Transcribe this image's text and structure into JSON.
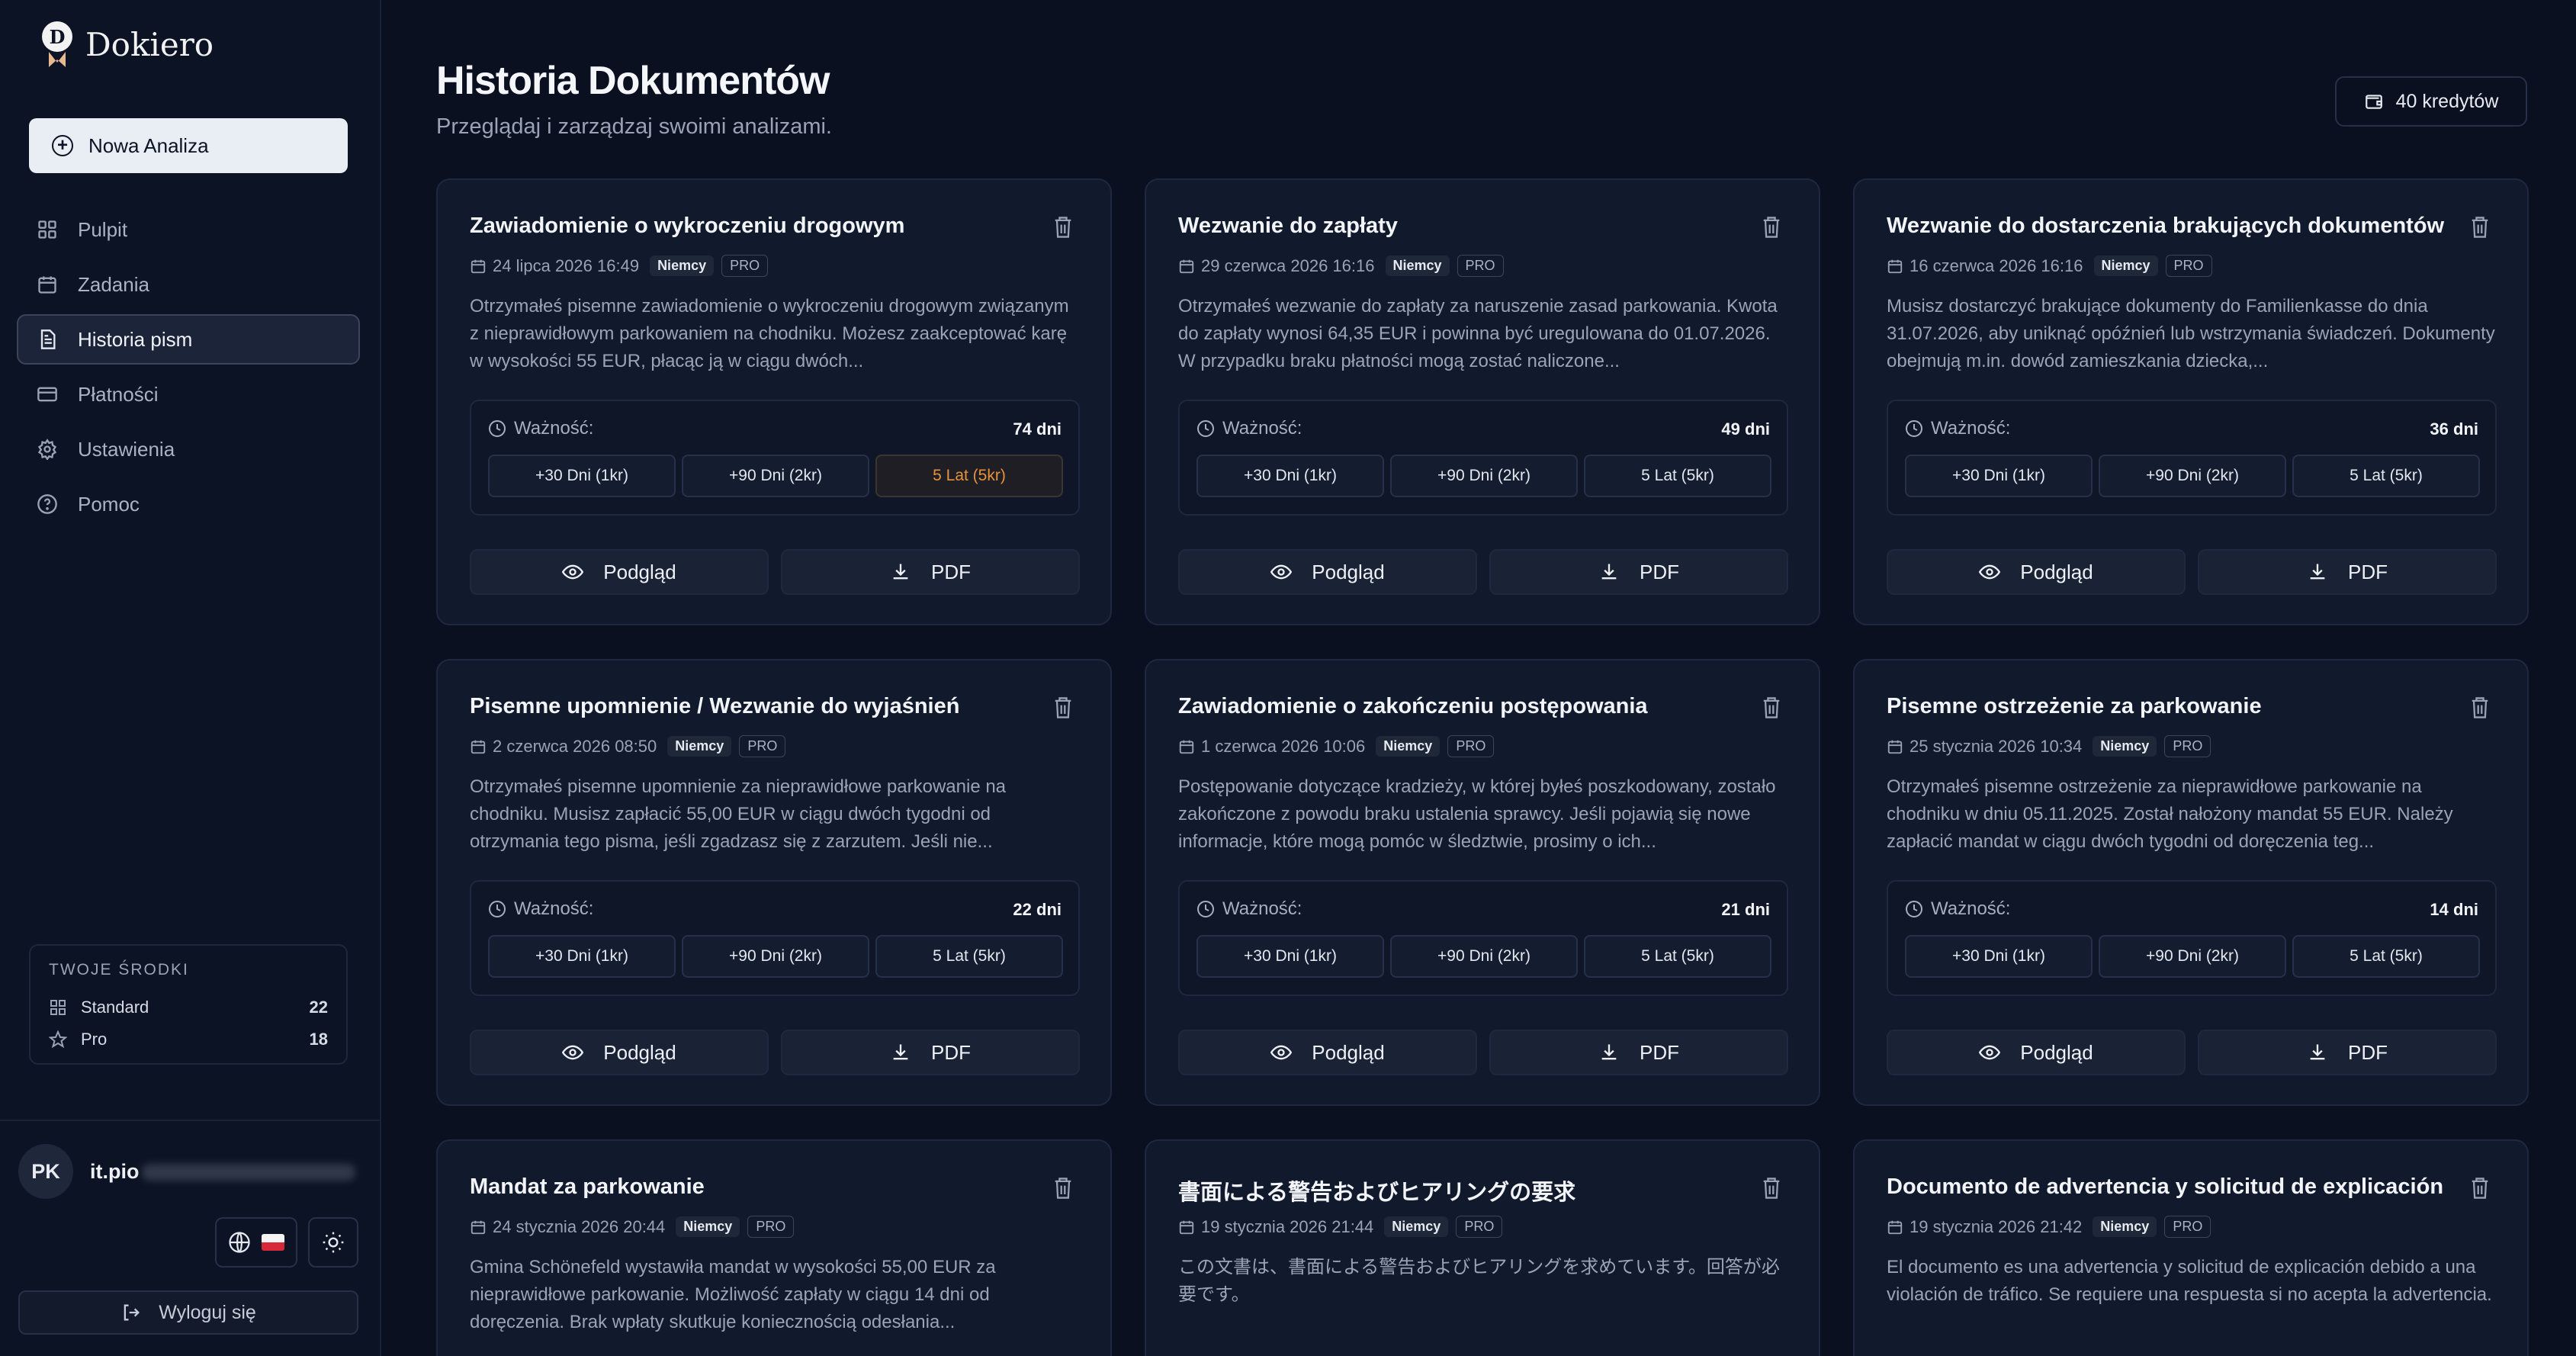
{
  "brand": {
    "name": "Dokiero",
    "logo_letter": "D"
  },
  "sidebar": {
    "new_analysis": "Nowa Analiza",
    "items": [
      {
        "label": "Pulpit",
        "icon": "grid-icon"
      },
      {
        "label": "Zadania",
        "icon": "calendar-icon"
      },
      {
        "label": "Historia pism",
        "icon": "document-icon",
        "active": true
      },
      {
        "label": "Płatności",
        "icon": "card-icon"
      },
      {
        "label": "Ustawienia",
        "icon": "gear-icon"
      },
      {
        "label": "Pomoc",
        "icon": "help-icon"
      }
    ],
    "credits": {
      "title": "TWOJE ŚRODKI",
      "rows": [
        {
          "label": "Standard",
          "value": "22"
        },
        {
          "label": "Pro",
          "value": "18"
        }
      ]
    },
    "user": {
      "initials": "PK",
      "email_visible": "it.pio"
    },
    "logout": "Wyloguj się"
  },
  "header": {
    "title": "Historia Dokumentów",
    "subtitle": "Przeglądaj i zarządzaj swoimi analizami.",
    "credits_badge": "40 kredytów"
  },
  "labels": {
    "validity": "Ważność:",
    "ext_30": "+30 Dni (1kr)",
    "ext_90": "+90 Dni (2kr)",
    "ext_5y": "5 Lat (5kr)",
    "preview": "Podgląd",
    "pdf": "PDF"
  },
  "cards": [
    {
      "title": "Zawiadomienie o wykroczeniu drogowym",
      "date": "24 lipca 2026 16:49",
      "lang": "Niemcy",
      "tier": "PRO",
      "desc": "Otrzymałeś pisemne zawiadomienie o wykroczeniu drogowym związanym z nieprawidłowym parkowaniem na chodniku. Możesz zaakceptować karę w wysokości 55 EUR, płacąc ją w ciągu dwóch...",
      "days": "74 dni",
      "highlight_5y": true
    },
    {
      "title": "Wezwanie do zapłaty",
      "date": "29 czerwca 2026 16:16",
      "lang": "Niemcy",
      "tier": "PRO",
      "desc": "Otrzymałeś wezwanie do zapłaty za naruszenie zasad parkowania. Kwota do zapłaty wynosi 64,35 EUR i powinna być uregulowana do 01.07.2026. W przypadku braku płatności mogą zostać naliczone...",
      "days": "49 dni",
      "highlight_5y": false
    },
    {
      "title": "Wezwanie do dostarczenia brakujących dokumentów",
      "date": "16 czerwca 2026 16:16",
      "lang": "Niemcy",
      "tier": "PRO",
      "desc": "Musisz dostarczyć brakujące dokumenty do Familienkasse do dnia 31.07.2026, aby uniknąć opóźnień lub wstrzymania świadczeń. Dokumenty obejmują m.in. dowód zamieszkania dziecka,...",
      "days": "36 dni",
      "highlight_5y": false
    },
    {
      "title": "Pisemne upomnienie / Wezwanie do wyjaśnień",
      "date": "2 czerwca 2026 08:50",
      "lang": "Niemcy",
      "tier": "PRO",
      "desc": "Otrzymałeś pisemne upomnienie za nieprawidłowe parkowanie na chodniku. Musisz zapłacić 55,00 EUR w ciągu dwóch tygodni od otrzymania tego pisma, jeśli zgadzasz się z zarzutem. Jeśli nie...",
      "days": "22 dni",
      "highlight_5y": false
    },
    {
      "title": "Zawiadomienie o zakończeniu postępowania",
      "date": "1 czerwca 2026 10:06",
      "lang": "Niemcy",
      "tier": "PRO",
      "desc": "Postępowanie dotyczące kradzieży, w której byłeś poszkodowany, zostało zakończone z powodu braku ustalenia sprawcy. Jeśli pojawią się nowe informacje, które mogą pomóc w śledztwie, prosimy o ich...",
      "days": "21 dni",
      "highlight_5y": false
    },
    {
      "title": "Pisemne ostrzeżenie za parkowanie",
      "date": "25 stycznia 2026 10:34",
      "lang": "Niemcy",
      "tier": "PRO",
      "desc": "Otrzymałeś pisemne ostrzeżenie za nieprawidłowe parkowanie na chodniku w dniu 05.11.2025. Został nałożony mandat 55 EUR. Należy zapłacić mandat w ciągu dwóch tygodni od doręczenia teg...",
      "days": "14 dni",
      "highlight_5y": false
    },
    {
      "title": "Mandat za parkowanie",
      "date": "24 stycznia 2026 20:44",
      "lang": "Niemcy",
      "tier": "PRO",
      "desc": "Gmina Schönefeld wystawiła mandat w wysokości 55,00 EUR za nieprawidłowe parkowanie. Możliwość zapłaty w ciągu 14 dni od doręczenia. Brak wpłaty skutkuje koniecznością odesłania..."
    },
    {
      "title": "書面による警告およびヒアリングの要求",
      "date": "19 stycznia 2026 21:44",
      "lang": "Niemcy",
      "tier": "PRO",
      "desc": "この文書は、書面による警告およびヒアリングを求めています。回答が必要です。"
    },
    {
      "title": "Documento de advertencia y solicitud de explicación",
      "date": "19 stycznia 2026 21:42",
      "lang": "Niemcy",
      "tier": "PRO",
      "desc": "El documento es una advertencia y solicitud de explicación debido a una violación de tráfico. Se requiere una respuesta si no acepta la advertencia."
    }
  ]
}
